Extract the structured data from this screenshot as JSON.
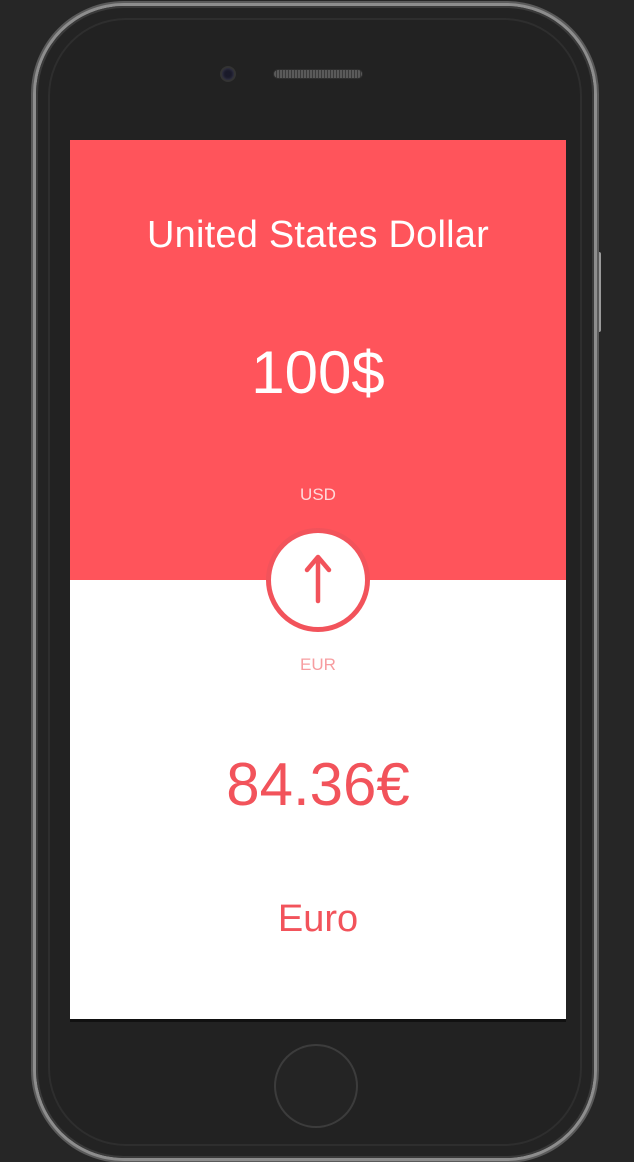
{
  "converter": {
    "from": {
      "name": "United States Dollar",
      "amount": "100$",
      "code": "USD"
    },
    "to": {
      "name": "Euro",
      "amount": "84.36€",
      "code": "EUR"
    },
    "swap_icon": "arrow-up-icon"
  },
  "colors": {
    "accent": "#ff545b",
    "text_on_accent": "#ffffff",
    "bottom_background": "#ffffff",
    "device_frame": "#232323"
  }
}
